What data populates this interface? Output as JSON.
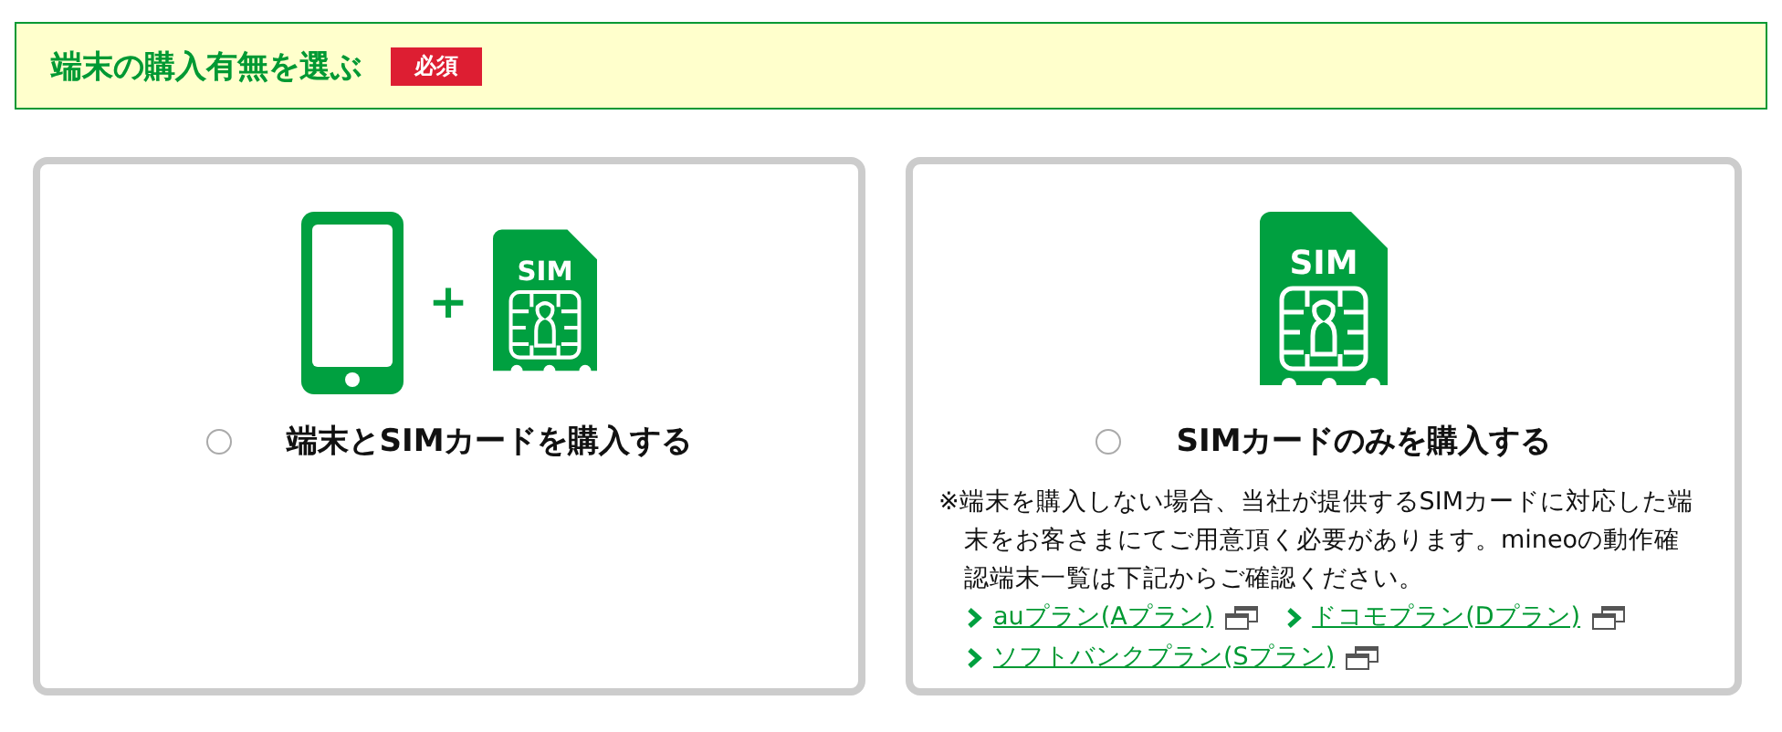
{
  "section": {
    "title": "端末の購入有無を選ぶ",
    "badge": "必須"
  },
  "options": [
    {
      "kind": "device_and_sim",
      "sim_text": "SIM",
      "plus": "+",
      "label": "端末とSIMカードを購入する",
      "selected": false
    },
    {
      "kind": "sim_only",
      "sim_text": "SIM",
      "label": "SIMカードのみを購入する",
      "selected": false,
      "note": "※端末を購入しない場合、当社が提供するSIMカードに対応した端末をお客さまにてご用意頂く必要があります。mineoの動作確認端末一覧は下記からご確認ください。",
      "links": [
        {
          "label": "auプラン(Aプラン)"
        },
        {
          "label": "ドコモプラン(Dプラン)"
        },
        {
          "label": "ソフトバンクプラン(Sプラン)"
        }
      ]
    }
  ]
}
